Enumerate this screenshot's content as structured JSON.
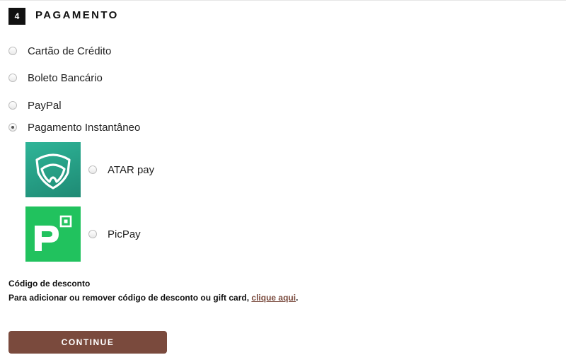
{
  "step": {
    "number": "4",
    "title": "PAGAMENTO"
  },
  "payment_options": [
    {
      "label": "Cartão de Crédito",
      "selected": false
    },
    {
      "label": "Boleto Bancário",
      "selected": false
    },
    {
      "label": "PayPal",
      "selected": false
    },
    {
      "label": "Pagamento Instantâneo",
      "selected": true
    }
  ],
  "instant_methods": [
    {
      "label": "ATAR pay",
      "icon": "atar-pay-logo-icon",
      "color": "#26a085"
    },
    {
      "label": "PicPay",
      "icon": "picpay-logo-icon",
      "color": "#21c25e"
    }
  ],
  "discount": {
    "title": "Código de desconto",
    "text": "Para adicionar ou remover código de desconto ou gift card, ",
    "link": "clique aqui",
    "end": "."
  },
  "continue_label": "CONTINUE",
  "colors": {
    "accent": "#7a4a3d",
    "badge": "#111111"
  }
}
